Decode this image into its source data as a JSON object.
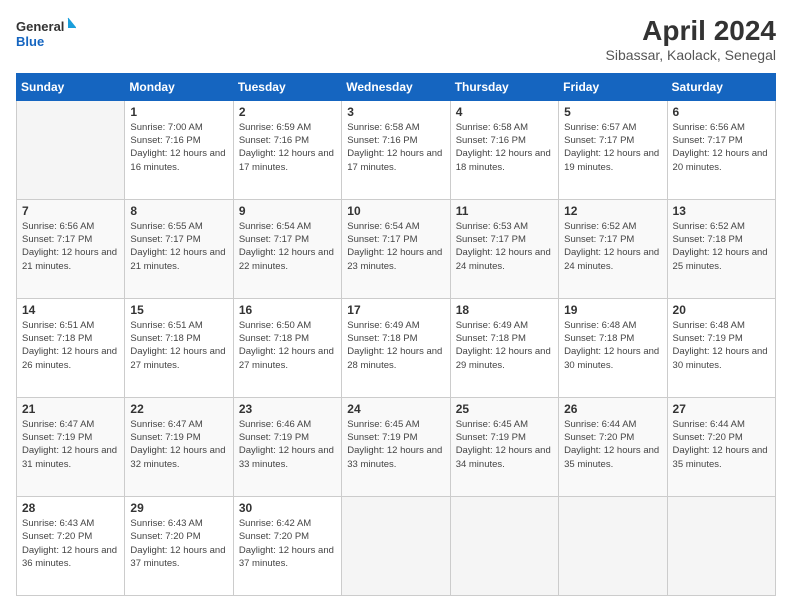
{
  "logo": {
    "line1": "General",
    "line2": "Blue"
  },
  "title": "April 2024",
  "subtitle": "Sibassar, Kaolack, Senegal",
  "header_days": [
    "Sunday",
    "Monday",
    "Tuesday",
    "Wednesday",
    "Thursday",
    "Friday",
    "Saturday"
  ],
  "weeks": [
    [
      {
        "day": "",
        "sunrise": "",
        "sunset": "",
        "daylight": ""
      },
      {
        "day": "1",
        "sunrise": "Sunrise: 7:00 AM",
        "sunset": "Sunset: 7:16 PM",
        "daylight": "Daylight: 12 hours and 16 minutes."
      },
      {
        "day": "2",
        "sunrise": "Sunrise: 6:59 AM",
        "sunset": "Sunset: 7:16 PM",
        "daylight": "Daylight: 12 hours and 17 minutes."
      },
      {
        "day": "3",
        "sunrise": "Sunrise: 6:58 AM",
        "sunset": "Sunset: 7:16 PM",
        "daylight": "Daylight: 12 hours and 17 minutes."
      },
      {
        "day": "4",
        "sunrise": "Sunrise: 6:58 AM",
        "sunset": "Sunset: 7:16 PM",
        "daylight": "Daylight: 12 hours and 18 minutes."
      },
      {
        "day": "5",
        "sunrise": "Sunrise: 6:57 AM",
        "sunset": "Sunset: 7:17 PM",
        "daylight": "Daylight: 12 hours and 19 minutes."
      },
      {
        "day": "6",
        "sunrise": "Sunrise: 6:56 AM",
        "sunset": "Sunset: 7:17 PM",
        "daylight": "Daylight: 12 hours and 20 minutes."
      }
    ],
    [
      {
        "day": "7",
        "sunrise": "Sunrise: 6:56 AM",
        "sunset": "Sunset: 7:17 PM",
        "daylight": "Daylight: 12 hours and 21 minutes."
      },
      {
        "day": "8",
        "sunrise": "Sunrise: 6:55 AM",
        "sunset": "Sunset: 7:17 PM",
        "daylight": "Daylight: 12 hours and 21 minutes."
      },
      {
        "day": "9",
        "sunrise": "Sunrise: 6:54 AM",
        "sunset": "Sunset: 7:17 PM",
        "daylight": "Daylight: 12 hours and 22 minutes."
      },
      {
        "day": "10",
        "sunrise": "Sunrise: 6:54 AM",
        "sunset": "Sunset: 7:17 PM",
        "daylight": "Daylight: 12 hours and 23 minutes."
      },
      {
        "day": "11",
        "sunrise": "Sunrise: 6:53 AM",
        "sunset": "Sunset: 7:17 PM",
        "daylight": "Daylight: 12 hours and 24 minutes."
      },
      {
        "day": "12",
        "sunrise": "Sunrise: 6:52 AM",
        "sunset": "Sunset: 7:17 PM",
        "daylight": "Daylight: 12 hours and 24 minutes."
      },
      {
        "day": "13",
        "sunrise": "Sunrise: 6:52 AM",
        "sunset": "Sunset: 7:18 PM",
        "daylight": "Daylight: 12 hours and 25 minutes."
      }
    ],
    [
      {
        "day": "14",
        "sunrise": "Sunrise: 6:51 AM",
        "sunset": "Sunset: 7:18 PM",
        "daylight": "Daylight: 12 hours and 26 minutes."
      },
      {
        "day": "15",
        "sunrise": "Sunrise: 6:51 AM",
        "sunset": "Sunset: 7:18 PM",
        "daylight": "Daylight: 12 hours and 27 minutes."
      },
      {
        "day": "16",
        "sunrise": "Sunrise: 6:50 AM",
        "sunset": "Sunset: 7:18 PM",
        "daylight": "Daylight: 12 hours and 27 minutes."
      },
      {
        "day": "17",
        "sunrise": "Sunrise: 6:49 AM",
        "sunset": "Sunset: 7:18 PM",
        "daylight": "Daylight: 12 hours and 28 minutes."
      },
      {
        "day": "18",
        "sunrise": "Sunrise: 6:49 AM",
        "sunset": "Sunset: 7:18 PM",
        "daylight": "Daylight: 12 hours and 29 minutes."
      },
      {
        "day": "19",
        "sunrise": "Sunrise: 6:48 AM",
        "sunset": "Sunset: 7:18 PM",
        "daylight": "Daylight: 12 hours and 30 minutes."
      },
      {
        "day": "20",
        "sunrise": "Sunrise: 6:48 AM",
        "sunset": "Sunset: 7:19 PM",
        "daylight": "Daylight: 12 hours and 30 minutes."
      }
    ],
    [
      {
        "day": "21",
        "sunrise": "Sunrise: 6:47 AM",
        "sunset": "Sunset: 7:19 PM",
        "daylight": "Daylight: 12 hours and 31 minutes."
      },
      {
        "day": "22",
        "sunrise": "Sunrise: 6:47 AM",
        "sunset": "Sunset: 7:19 PM",
        "daylight": "Daylight: 12 hours and 32 minutes."
      },
      {
        "day": "23",
        "sunrise": "Sunrise: 6:46 AM",
        "sunset": "Sunset: 7:19 PM",
        "daylight": "Daylight: 12 hours and 33 minutes."
      },
      {
        "day": "24",
        "sunrise": "Sunrise: 6:45 AM",
        "sunset": "Sunset: 7:19 PM",
        "daylight": "Daylight: 12 hours and 33 minutes."
      },
      {
        "day": "25",
        "sunrise": "Sunrise: 6:45 AM",
        "sunset": "Sunset: 7:19 PM",
        "daylight": "Daylight: 12 hours and 34 minutes."
      },
      {
        "day": "26",
        "sunrise": "Sunrise: 6:44 AM",
        "sunset": "Sunset: 7:20 PM",
        "daylight": "Daylight: 12 hours and 35 minutes."
      },
      {
        "day": "27",
        "sunrise": "Sunrise: 6:44 AM",
        "sunset": "Sunset: 7:20 PM",
        "daylight": "Daylight: 12 hours and 35 minutes."
      }
    ],
    [
      {
        "day": "28",
        "sunrise": "Sunrise: 6:43 AM",
        "sunset": "Sunset: 7:20 PM",
        "daylight": "Daylight: 12 hours and 36 minutes."
      },
      {
        "day": "29",
        "sunrise": "Sunrise: 6:43 AM",
        "sunset": "Sunset: 7:20 PM",
        "daylight": "Daylight: 12 hours and 37 minutes."
      },
      {
        "day": "30",
        "sunrise": "Sunrise: 6:42 AM",
        "sunset": "Sunset: 7:20 PM",
        "daylight": "Daylight: 12 hours and 37 minutes."
      },
      {
        "day": "",
        "sunrise": "",
        "sunset": "",
        "daylight": ""
      },
      {
        "day": "",
        "sunrise": "",
        "sunset": "",
        "daylight": ""
      },
      {
        "day": "",
        "sunrise": "",
        "sunset": "",
        "daylight": ""
      },
      {
        "day": "",
        "sunrise": "",
        "sunset": "",
        "daylight": ""
      }
    ]
  ]
}
